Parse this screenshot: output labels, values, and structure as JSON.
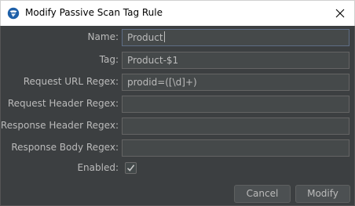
{
  "window": {
    "title": "Modify Passive Scan Tag Rule"
  },
  "form": {
    "name_label": "Name:",
    "name_value": "Product",
    "tag_label": "Tag:",
    "tag_value": "Product-$1",
    "request_url_regex_label": "Request URL Regex:",
    "request_url_regex_value": "prodid=([\\d]+)",
    "request_header_regex_label": "Request Header Regex:",
    "request_header_regex_value": "",
    "response_header_regex_label": "Response Header Regex:",
    "response_header_regex_value": "",
    "response_body_regex_label": "Response Body Regex:",
    "response_body_regex_value": "",
    "enabled_label": "Enabled:",
    "enabled_checked": true
  },
  "buttons": {
    "cancel_label": "Cancel",
    "modify_label": "Modify"
  },
  "icons": {
    "app": "zap-app-icon",
    "close": "close-icon",
    "check": "checkmark-icon"
  }
}
